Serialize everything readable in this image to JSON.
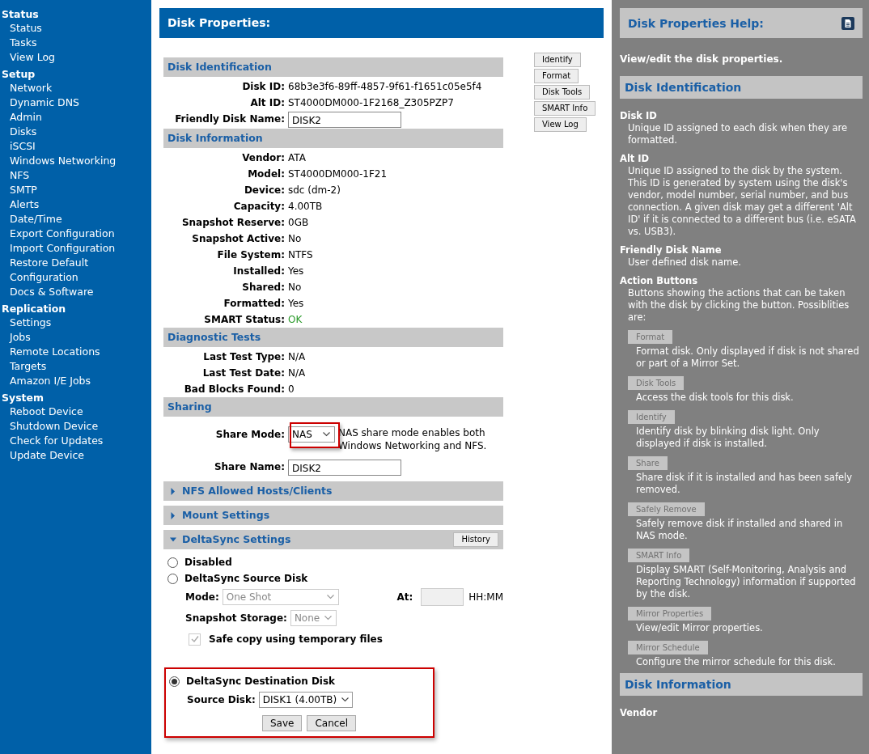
{
  "sidebar": [
    {
      "title": "Status",
      "items": [
        "Status",
        "Tasks",
        "View Log"
      ]
    },
    {
      "title": "Setup",
      "items": [
        "Network",
        "Dynamic DNS",
        "Admin",
        "Disks",
        "iSCSI",
        "Windows Networking",
        "NFS",
        "SMTP",
        "Alerts",
        "Date/Time",
        "Export Configuration",
        "Import Configuration",
        "Restore Default Configuration",
        "Docs & Software"
      ]
    },
    {
      "title": "Replication",
      "items": [
        "Settings",
        "Jobs",
        "Remote Locations",
        "Targets",
        "Amazon I/E Jobs"
      ]
    },
    {
      "title": "System",
      "items": [
        "Reboot Device",
        "Shutdown Device",
        "Check for Updates",
        "Update Device"
      ]
    }
  ],
  "page_title": "Disk Properties:",
  "action_buttons": [
    "Identify",
    "Format",
    "Disk Tools",
    "SMART Info",
    "View Log"
  ],
  "sections": [
    {
      "kind": "info",
      "title": "Disk Identification",
      "fields": [
        {
          "label": "Disk ID:",
          "value": "68b3e3f6-89ff-4857-9f61-f1651c05e5f4",
          "kind": "text"
        },
        {
          "label": "Alt ID:",
          "value": "ST4000DM000-1F2168_Z305PZP7",
          "kind": "text"
        },
        {
          "label": "Friendly Disk Name:",
          "value": "DISK2",
          "kind": "input"
        }
      ]
    },
    {
      "kind": "info",
      "title": "Disk Information",
      "fields": [
        {
          "label": "Vendor:",
          "value": "ATA",
          "kind": "text"
        },
        {
          "label": "Model:",
          "value": "ST4000DM000-1F21",
          "kind": "text"
        },
        {
          "label": "Device:",
          "value": "sdc (dm-2)",
          "kind": "text"
        },
        {
          "label": "Capacity:",
          "value": "4.00TB",
          "kind": "text"
        },
        {
          "label": "Snapshot Reserve:",
          "value": "0GB",
          "kind": "text"
        },
        {
          "label": "Snapshot Active:",
          "value": "No",
          "kind": "text"
        },
        {
          "label": "File System:",
          "value": "NTFS",
          "kind": "text"
        },
        {
          "label": "Installed:",
          "value": "Yes",
          "kind": "text"
        },
        {
          "label": "Shared:",
          "value": "No",
          "kind": "text"
        },
        {
          "label": "Formatted:",
          "value": "Yes",
          "kind": "text"
        },
        {
          "label": "SMART Status:",
          "value": "OK",
          "kind": "status"
        }
      ]
    },
    {
      "kind": "info",
      "title": "Diagnostic Tests",
      "fields": [
        {
          "label": "Last Test Type:",
          "value": "N/A",
          "kind": "text"
        },
        {
          "label": "Last Test Date:",
          "value": "N/A",
          "kind": "text"
        },
        {
          "label": "Bad Blocks Found:",
          "value": "0",
          "kind": "text"
        }
      ]
    },
    {
      "kind": "sharing",
      "title": "Sharing",
      "share_mode": {
        "label": "Share Mode:",
        "value": "NAS",
        "note": "NAS share mode enables both Windows Networking and NFS.",
        "highlighted": true
      },
      "share_name": {
        "label": "Share Name:",
        "value": "DISK2"
      }
    },
    {
      "kind": "collapsible",
      "title": "NFS Allowed Hosts/Clients",
      "expanded": false
    },
    {
      "kind": "collapsible",
      "title": "Mount Settings",
      "expanded": false
    },
    {
      "kind": "deltasync",
      "title": "DeltaSync Settings",
      "expanded": true,
      "button": "History",
      "options": [
        {
          "label": "Disabled",
          "selected": false
        },
        {
          "label": "DeltaSync Source Disk",
          "selected": false
        },
        {
          "label": "DeltaSync Destination Disk",
          "selected": true,
          "highlighted": true
        }
      ],
      "mode": {
        "label": "Mode:",
        "value": "One Shot"
      },
      "at": {
        "label": "At:",
        "suffix": "HH:MM"
      },
      "snapshot_storage": {
        "label": "Snapshot Storage:",
        "value": "None"
      },
      "safe_copy": {
        "label": "Safe copy using temporary files",
        "checked": true
      },
      "source_disk": {
        "label": "Source Disk:",
        "value": "DISK1 (4.00TB)"
      },
      "buttons": [
        "Save",
        "Cancel"
      ]
    }
  ],
  "help": {
    "title": "Disk Properties Help:",
    "intro": "View/edit the disk properties.",
    "sections": [
      {
        "title": "Disk Identification",
        "entries": [
          {
            "term": "Disk ID",
            "text": "Unique ID assigned to each disk when they are formatted."
          },
          {
            "term": "Alt ID",
            "text": "Unique ID assigned to the disk by the system. This ID is generated by system using the disk's vendor, model number, serial number, and bus connection. A given disk may get a different 'Alt ID' if it is connected to a different bus (i.e. eSATA vs. USB3)."
          },
          {
            "term": "Friendly Disk Name",
            "text": "User defined disk name."
          },
          {
            "term": "Action Buttons",
            "text": "Buttons showing the actions that can be taken with the disk by clicking the button. Possiblities are:",
            "buttons": [
              {
                "label": "Format",
                "text": "Format disk. Only displayed if disk is not shared or part of a Mirror Set."
              },
              {
                "label": "Disk Tools",
                "text": "Access the disk tools for this disk."
              },
              {
                "label": "Identify",
                "text": "Identify disk by blinking disk light. Only displayed if disk is installed."
              },
              {
                "label": "Share",
                "text": "Share disk if it is installed and has been safely removed."
              },
              {
                "label": "Safely Remove",
                "text": "Safely remove disk if installed and shared in NAS mode."
              },
              {
                "label": "SMART Info",
                "text": "Display SMART (Self-Monitoring, Analysis and Reporting Technology) information if supported by the disk."
              },
              {
                "label": "Mirror Properties",
                "text": "View/edit Mirror properties."
              },
              {
                "label": "Mirror Schedule",
                "text": "Configure the mirror schedule for this disk."
              }
            ]
          }
        ]
      },
      {
        "title": "Disk Information",
        "entries": [
          {
            "term": "Vendor"
          }
        ]
      }
    ]
  }
}
